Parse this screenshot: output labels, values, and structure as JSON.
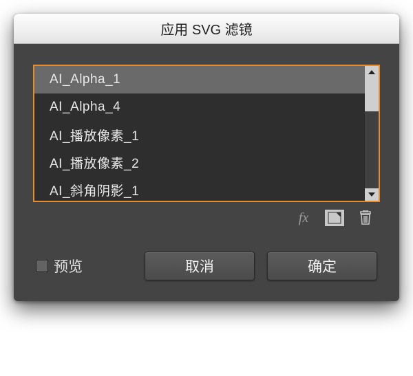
{
  "title": "应用 SVG 滤镜",
  "list": {
    "items": [
      {
        "label": "AI_Alpha_1",
        "selected": true
      },
      {
        "label": "AI_Alpha_4",
        "selected": false
      },
      {
        "label": "AI_播放像素_1",
        "selected": false
      },
      {
        "label": "AI_播放像素_2",
        "selected": false
      },
      {
        "label": "AI_斜角阴影_1",
        "selected": false
      }
    ]
  },
  "toolbar": {
    "fx_label": "fx"
  },
  "footer": {
    "preview_label": "预览",
    "cancel_label": "取消",
    "ok_label": "确定"
  }
}
